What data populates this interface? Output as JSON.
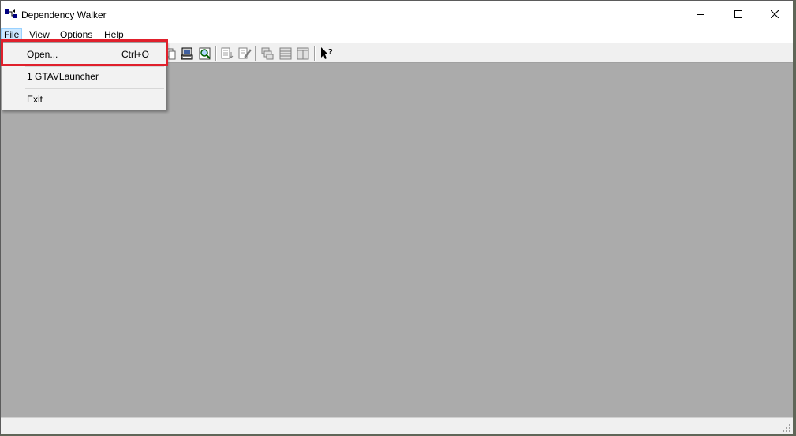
{
  "window": {
    "title": "Dependency Walker",
    "controls": {
      "minimize": "minimize-icon",
      "maximize": "maximize-icon",
      "close": "close-icon"
    }
  },
  "menubar": {
    "items": [
      "File",
      "View",
      "Options",
      "Help"
    ],
    "active": "File"
  },
  "file_menu": {
    "items": [
      {
        "label": "Open...",
        "shortcut": "Ctrl+O"
      },
      {
        "label": "1 GTAVLauncher"
      },
      {
        "label": "Exit"
      }
    ]
  },
  "highlight_color": "#e0202c",
  "colors": {
    "client_area": "#ababab",
    "menu_active": "#cce8ff",
    "toolbar": "#f0f0f0"
  }
}
